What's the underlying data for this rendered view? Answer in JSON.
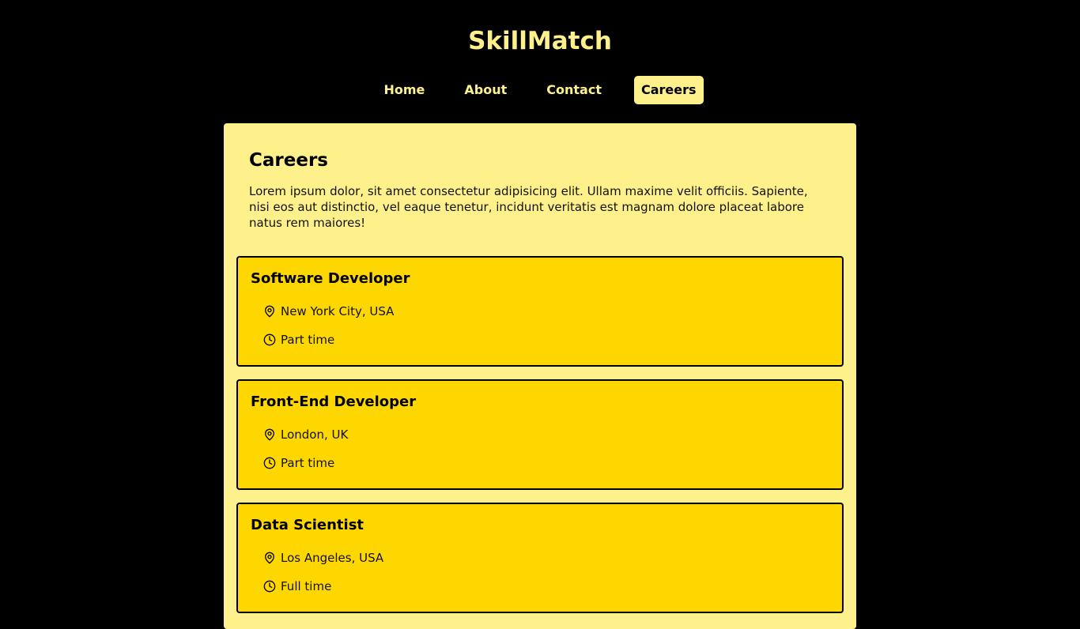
{
  "brand": {
    "name": "SkillMatch"
  },
  "nav": {
    "items": [
      {
        "label": "Home",
        "active": false
      },
      {
        "label": "About",
        "active": false
      },
      {
        "label": "Contact",
        "active": false
      },
      {
        "label": "Careers",
        "active": true
      }
    ]
  },
  "page": {
    "title": "Careers",
    "intro": "Lorem ipsum dolor, sit amet consectetur adipisicing elit. Ullam maxime velit officiis. Sapiente, nisi eos aut distinctio, vel eaque tenetur, incidunt veritatis est magnam dolore placeat labore natus rem maiores!"
  },
  "jobs": [
    {
      "title": "Software Developer",
      "location": "New York City, USA",
      "type": "Part time"
    },
    {
      "title": "Front-End Developer",
      "location": "London, UK",
      "type": "Part time"
    },
    {
      "title": "Data Scientist",
      "location": "Los Angeles, USA",
      "type": "Full time"
    }
  ],
  "icons": {
    "location": "map-pin-icon",
    "type": "clock-icon"
  },
  "colors": {
    "background": "#000000",
    "accent": "#FEF08A",
    "card": "#FFD700",
    "text": "#000000"
  }
}
